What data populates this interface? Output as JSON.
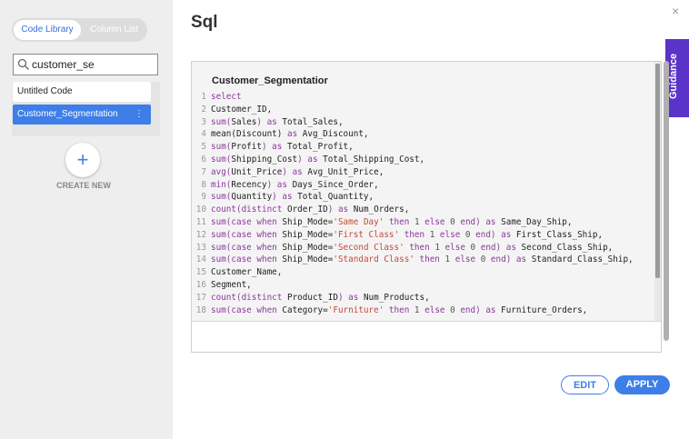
{
  "sidebar": {
    "tabs": [
      "Code Library",
      "Column List"
    ],
    "search_value": "customer_se",
    "items": [
      "Untitled Code",
      "Customer_Segmentation"
    ],
    "create_label": "CREATE NEW"
  },
  "dialog": {
    "title": "Sql",
    "close_label": "×",
    "guidance_label": "Guidance",
    "edit_label": "EDIT",
    "apply_label": "APPLY"
  },
  "editor": {
    "title": "Customer_Segmentatior",
    "lines": [
      [
        [
          "kw",
          "select"
        ]
      ],
      [
        [
          "tx",
          "Customer_ID,"
        ]
      ],
      [
        [
          "kw",
          "sum("
        ],
        [
          "tx",
          "Sales"
        ],
        [
          "kw",
          ") as "
        ],
        [
          "tx",
          "Total_Sales,"
        ]
      ],
      [
        [
          "tx",
          "mean(Discount) "
        ],
        [
          "kw",
          "as "
        ],
        [
          "tx",
          "Avg_Discount,"
        ]
      ],
      [
        [
          "kw",
          "sum("
        ],
        [
          "tx",
          "Profit"
        ],
        [
          "kw",
          ") as "
        ],
        [
          "tx",
          "Total_Profit,"
        ]
      ],
      [
        [
          "kw",
          "sum("
        ],
        [
          "tx",
          "Shipping_Cost"
        ],
        [
          "kw",
          ") as "
        ],
        [
          "tx",
          "Total_Shipping_Cost,"
        ]
      ],
      [
        [
          "kw",
          "avg("
        ],
        [
          "tx",
          "Unit_Price"
        ],
        [
          "kw",
          ") as "
        ],
        [
          "tx",
          "Avg_Unit_Price,"
        ]
      ],
      [
        [
          "kw",
          "min("
        ],
        [
          "tx",
          "Recency"
        ],
        [
          "kw",
          ") as "
        ],
        [
          "tx",
          "Days_Since_Order,"
        ]
      ],
      [
        [
          "kw",
          "sum("
        ],
        [
          "tx",
          "Quantity"
        ],
        [
          "kw",
          ") as "
        ],
        [
          "tx",
          "Total_Quantity,"
        ]
      ],
      [
        [
          "kw",
          "count(distinct "
        ],
        [
          "tx",
          "Order_ID"
        ],
        [
          "kw",
          ") as "
        ],
        [
          "tx",
          "Num_Orders,"
        ]
      ],
      [
        [
          "kw",
          "sum(case when "
        ],
        [
          "tx",
          "Ship_Mode="
        ],
        [
          "str",
          "'Same Day'"
        ],
        [
          "kw",
          " then "
        ],
        [
          "num",
          "1"
        ],
        [
          "kw",
          " else "
        ],
        [
          "num",
          "0"
        ],
        [
          "kw",
          " end) as "
        ],
        [
          "tx",
          "Same_Day_Ship,"
        ]
      ],
      [
        [
          "kw",
          "sum(case when "
        ],
        [
          "tx",
          "Ship_Mode="
        ],
        [
          "str",
          "'First Class'"
        ],
        [
          "kw",
          " then "
        ],
        [
          "num",
          "1"
        ],
        [
          "kw",
          " else "
        ],
        [
          "num",
          "0"
        ],
        [
          "kw",
          " end) as "
        ],
        [
          "tx",
          "First_Class_Ship,"
        ]
      ],
      [
        [
          "kw",
          "sum(case when "
        ],
        [
          "tx",
          "Ship_Mode="
        ],
        [
          "str",
          "'Second Class'"
        ],
        [
          "kw",
          " then "
        ],
        [
          "num",
          "1"
        ],
        [
          "kw",
          " else "
        ],
        [
          "num",
          "0"
        ],
        [
          "kw",
          " end) as "
        ],
        [
          "tx",
          "Second_Class_Ship,"
        ]
      ],
      [
        [
          "kw",
          "sum(case when "
        ],
        [
          "tx",
          "Ship_Mode="
        ],
        [
          "str",
          "'Standard Class'"
        ],
        [
          "kw",
          " then "
        ],
        [
          "num",
          "1"
        ],
        [
          "kw",
          " else "
        ],
        [
          "num",
          "0"
        ],
        [
          "kw",
          " end) as "
        ],
        [
          "tx",
          "Standard_Class_Ship,"
        ]
      ],
      [
        [
          "tx",
          "Customer_Name,"
        ]
      ],
      [
        [
          "tx",
          "Segment,"
        ]
      ],
      [
        [
          "kw",
          "count(distinct "
        ],
        [
          "tx",
          "Product_ID"
        ],
        [
          "kw",
          ") as "
        ],
        [
          "tx",
          "Num_Products,"
        ]
      ],
      [
        [
          "kw",
          "sum(case when "
        ],
        [
          "tx",
          "Category="
        ],
        [
          "str",
          "'Furniture'"
        ],
        [
          "kw",
          " then "
        ],
        [
          "num",
          "1"
        ],
        [
          "kw",
          " else "
        ],
        [
          "num",
          "0"
        ],
        [
          "kw",
          " end) as "
        ],
        [
          "tx",
          "Furniture_Orders,"
        ]
      ]
    ]
  },
  "colors": {
    "accent": "#3e7ee8",
    "guidance": "#5a33c8",
    "keyword": "#8a3a9a",
    "string": "#c44a3a"
  }
}
